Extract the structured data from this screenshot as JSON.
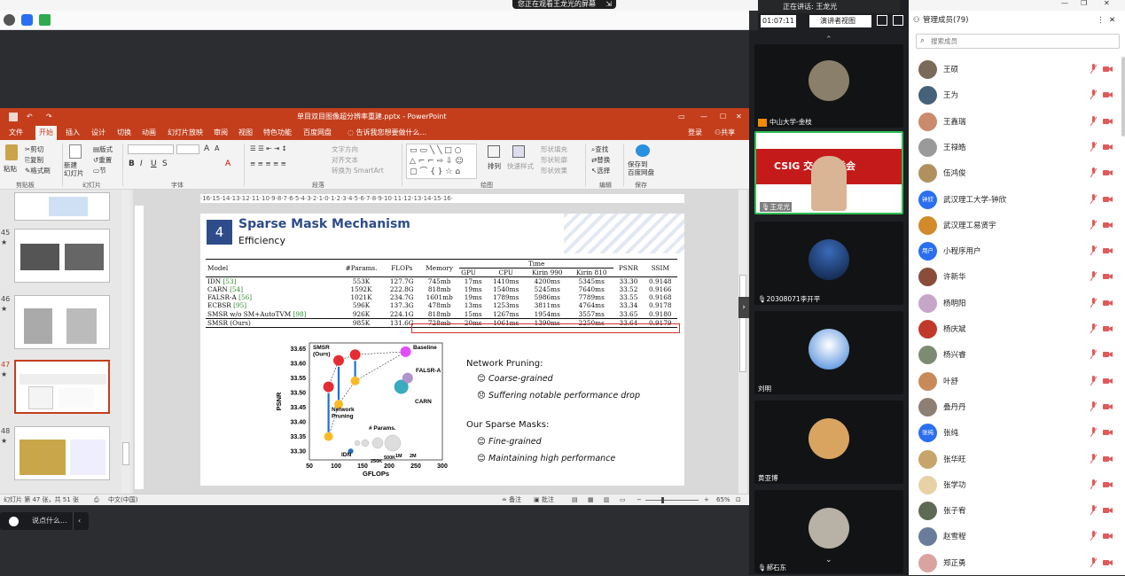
{
  "share_banner": {
    "text": "您正在观看王龙光的屏幕",
    "exit_icon": "exit-icon"
  },
  "speaker_bar": {
    "speaking_label": "正在讲话: 王龙光",
    "timer": "01:07:11",
    "view_label": "演讲者视图"
  },
  "ppt": {
    "window_title": "单目双目图像超分辨率重建.pptx - PowerPoint",
    "tabs": [
      "文件",
      "开始",
      "插入",
      "设计",
      "切换",
      "动画",
      "幻灯片放映",
      "审阅",
      "视图",
      "特色功能",
      "百度网盘"
    ],
    "active_tab": "开始",
    "tell_me": "告诉我您想要做什么...",
    "login": "登录",
    "share": "共享",
    "ribbon": {
      "paste": "粘贴",
      "cut": "剪切",
      "copy": "复制",
      "format_painter": "格式刷",
      "clipboard": "剪贴板",
      "new_slide": "新建\n幻灯片",
      "layout": "版式",
      "reset": "重置",
      "section": "节",
      "slides": "幻灯片",
      "font": "字体",
      "text_direction": "文字方向",
      "align_text": "对齐文本",
      "smartart": "转换为 SmartArt",
      "paragraph": "段落",
      "arrange": "排列",
      "quick_styles": "快速样式",
      "shape_fill": "形状填充",
      "shape_outline": "形状轮廓",
      "shape_effects": "形状效果",
      "drawing": "绘图",
      "find": "查找",
      "replace": "替换",
      "select": "选择",
      "editing": "编辑",
      "save_to": "保存到\n百度网盘",
      "save_group": "保存"
    },
    "ruler": "·16·15·14·13·12·11·10·9·8·7·6·5·4·3·2·1·0·1·2·3·4·5·6·7·8·9·10·11·12·13·14·15·16·",
    "thumbnails": [
      {
        "num": "45"
      },
      {
        "num": "46"
      },
      {
        "num": "47"
      },
      {
        "num": "48"
      }
    ],
    "status": {
      "slide_info": "幻灯片 第 47 张，共 51 张",
      "language": "中文(中国)",
      "notes": "备注",
      "comments": "批注",
      "zoom": "65%"
    }
  },
  "slide": {
    "number": "4",
    "title": "Sparse Mask Mechanism",
    "subtitle": "Efficiency",
    "table": {
      "header_top": [
        "Model",
        "#Params.",
        "FLOPs",
        "Memory",
        "Time",
        "PSNR",
        "SSIM"
      ],
      "header_sub": [
        "GPU",
        "CPU",
        "Kirin 990",
        "Kirin 810"
      ],
      "rows": [
        {
          "model": "IDN",
          "ref": "[53]",
          "params": "553K",
          "flops": "127.7G",
          "memory": "745mb",
          "gpu": "17ms",
          "cpu": "1410ms",
          "k990": "4200ms",
          "k810": "5345ms",
          "psnr": "33.30",
          "ssim": "0.9148"
        },
        {
          "model": "CARN",
          "ref": "[54]",
          "params": "1592K",
          "flops": "222.8G",
          "memory": "818mb",
          "gpu": "19ms",
          "cpu": "1540ms",
          "k990": "5245ms",
          "k810": "7640ms",
          "psnr": "33.52",
          "ssim": "0.9166"
        },
        {
          "model": "FALSR-A",
          "ref": "[56]",
          "params": "1021K",
          "flops": "234.7G",
          "memory": "1601mb",
          "gpu": "19ms",
          "cpu": "1789ms",
          "k990": "5986ms",
          "k810": "7789ms",
          "psnr": "33.55",
          "ssim": "0.9168"
        },
        {
          "model": "ECBSR",
          "ref": "[95]",
          "params": "596K",
          "flops": "137.3G",
          "memory": "478mb",
          "gpu": "13ms",
          "cpu": "1253ms",
          "k990": "3811ms",
          "k810": "4764ms",
          "psnr": "33.34",
          "ssim": "0.9178"
        },
        {
          "model": "SMSR w/o SM+AutoTVM",
          "ref": "[98]",
          "params": "926K",
          "flops": "224.1G",
          "memory": "818mb",
          "gpu": "15ms",
          "cpu": "1267ms",
          "k990": "1954ms",
          "k810": "3557ms",
          "psnr": "33.65",
          "ssim": "0.9180"
        },
        {
          "model": "SMSR (Ours)",
          "ref": "",
          "params": "985K",
          "flops": "131.6G",
          "memory": "728mb",
          "gpu": "20ms",
          "cpu": "1061ms",
          "k990": "1390ms",
          "k810": "2250ms",
          "psnr": "33.64",
          "ssim": "0.9179"
        }
      ]
    },
    "bullets": {
      "np_title": "Network Pruning:",
      "np_items": [
        "Coarse-grained",
        "Suffering notable performance drop"
      ],
      "sm_title": "Our Sparse Masks:",
      "sm_items": [
        "Fine-grained",
        "Maintaining high performance"
      ]
    }
  },
  "chart_data": {
    "type": "scatter",
    "xlabel": "GFLOPs",
    "ylabel": "PSNR",
    "xlim": [
      50,
      300
    ],
    "ylim": [
      33.27,
      33.67
    ],
    "xticks": [
      50,
      100,
      150,
      200,
      250,
      300
    ],
    "yticks": [
      33.3,
      33.35,
      33.4,
      33.45,
      33.5,
      33.55,
      33.6,
      33.65
    ],
    "points": [
      {
        "name": "IDN",
        "x": 127.7,
        "y": 33.3,
        "color": "#1565c0",
        "r": 3
      },
      {
        "name": "CARN",
        "x": 222.8,
        "y": 33.52,
        "color": "#29a3b8",
        "r": 8
      },
      {
        "name": "FALSR-A",
        "x": 234.7,
        "y": 33.55,
        "color": "#a98bc9",
        "r": 6
      },
      {
        "name": "Baseline",
        "x": 231,
        "y": 33.64,
        "color": "#e040fb",
        "r": 6
      },
      {
        "name": "",
        "x": 86,
        "y": 33.35,
        "color": "#f9b515",
        "r": 5
      },
      {
        "name": "",
        "x": 86,
        "y": 33.52,
        "color": "#e31b23",
        "r": 6
      },
      {
        "name": "",
        "x": 105,
        "y": 33.46,
        "color": "#f9b515",
        "r": 5
      },
      {
        "name": "",
        "x": 105,
        "y": 33.61,
        "color": "#e31b23",
        "r": 6
      },
      {
        "name": "",
        "x": 136,
        "y": 33.54,
        "color": "#f9b515",
        "r": 5
      },
      {
        "name": "",
        "x": 136,
        "y": 33.63,
        "color": "#e31b23",
        "r": 6
      }
    ],
    "labels": {
      "smsr": "SMSR\n(Ours)",
      "baseline": "Baseline",
      "falsr": "FALSR-A",
      "carn": "CARN",
      "pruning": "Network\nPruning",
      "idn": "IDN",
      "params": "# Params.",
      "p_small": "250K",
      "p_mid": "500K",
      "p_1m": "1M",
      "p_2m": "2M"
    }
  },
  "videos": [
    {
      "name": "中山大学-金枝"
    },
    {
      "name": "王龙光",
      "banner": "CSIG  交  频专委会"
    },
    {
      "name": "20308071李开平"
    },
    {
      "name": "刘明"
    },
    {
      "name": "黄亚博"
    },
    {
      "name": "郝石东"
    }
  ],
  "members_panel": {
    "title": "管理成员(79)",
    "search_placeholder": "搜索成员",
    "members": [
      {
        "name": "王硕",
        "color": "#7a6a5a",
        "initials": ""
      },
      {
        "name": "王为",
        "color": "#46617a",
        "initials": ""
      },
      {
        "name": "王鑫瑞",
        "color": "#c98b6b",
        "initials": ""
      },
      {
        "name": "王禄皓",
        "color": "#9a9a9a",
        "initials": ""
      },
      {
        "name": "伍鸿俊",
        "color": "#b0915e",
        "initials": ""
      },
      {
        "name": "武汉理工大学-钟欣",
        "color": "#2a6ff2",
        "initials": "钟欣"
      },
      {
        "name": "武汉理工易贤宇",
        "color": "#d28a2a",
        "initials": ""
      },
      {
        "name": "小程序用户",
        "color": "#2a6ff2",
        "initials": "用户"
      },
      {
        "name": "许新华",
        "color": "#8a4d3a",
        "initials": ""
      },
      {
        "name": "杨明阳",
        "color": "#c6a6c8",
        "initials": ""
      },
      {
        "name": "杨庆斌",
        "color": "#c0392b",
        "initials": ""
      },
      {
        "name": "杨兴睿",
        "color": "#7d8b72",
        "initials": ""
      },
      {
        "name": "叶舒",
        "color": "#c98a5a",
        "initials": ""
      },
      {
        "name": "叠丹丹",
        "color": "#8d7f73",
        "initials": ""
      },
      {
        "name": "张纯",
        "color": "#2a6ff2",
        "initials": "张纯"
      },
      {
        "name": "张华旺",
        "color": "#c7a46a",
        "initials": ""
      },
      {
        "name": "张学功",
        "color": "#e7d2a6",
        "initials": ""
      },
      {
        "name": "张子宥",
        "color": "#5f6a55",
        "initials": ""
      },
      {
        "name": "赵雪程",
        "color": "#6a7c9a",
        "initials": ""
      },
      {
        "name": "郑正勇",
        "color": "#d9a4a0",
        "initials": ""
      }
    ]
  },
  "chat": {
    "placeholder": "说点什么..."
  }
}
